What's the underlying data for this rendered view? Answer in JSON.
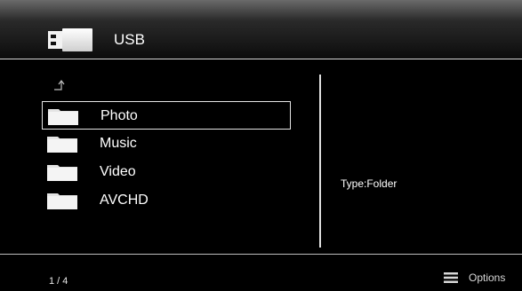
{
  "header": {
    "title": "USB",
    "icon": "usb-drive-icon"
  },
  "list": {
    "parent_icon": "up-arrow-icon",
    "selected_index": 0,
    "items": [
      {
        "label": "Photo",
        "icon": "folder-icon"
      },
      {
        "label": "Music",
        "icon": "folder-icon"
      },
      {
        "label": "Video",
        "icon": "folder-icon"
      },
      {
        "label": "AVCHD",
        "icon": "folder-icon"
      }
    ]
  },
  "info": {
    "type_text": "Type:Folder"
  },
  "footer": {
    "page_count": "1 / 4",
    "options_label": "Options",
    "options_icon": "menu-lines-icon"
  },
  "colors": {
    "background": "#000000",
    "text": "#ffffff",
    "rule": "#d8d8d8"
  }
}
